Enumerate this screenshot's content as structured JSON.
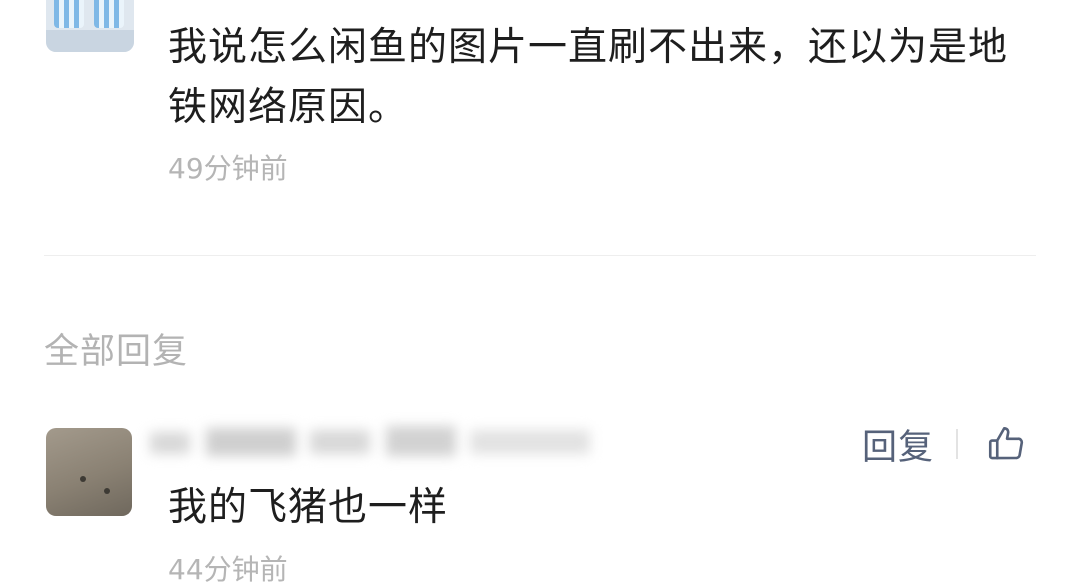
{
  "top_comment": {
    "text": "我说怎么闲鱼的图片一直刷不出来，还以为是地铁网络原因。",
    "time": "49分钟前"
  },
  "replies_section": {
    "title": "全部回复"
  },
  "reply": {
    "text": "我的飞猪也一样",
    "time": "44分钟前",
    "reply_label": "回复",
    "like_icon": "thumbs-up-icon"
  },
  "colors": {
    "text_primary": "#1e1e1e",
    "text_muted": "#b5b5b5",
    "action_blue_gray": "#56627a",
    "divider": "#eeeeee"
  }
}
